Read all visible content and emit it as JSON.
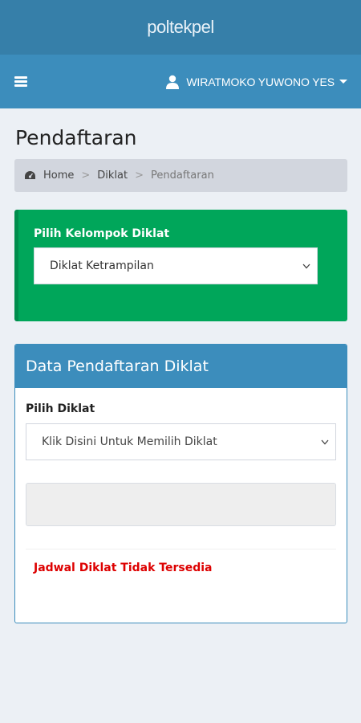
{
  "app": {
    "brand": "poltekpel"
  },
  "navbar": {
    "user_name": "WIRATMOKO YUWONO YES"
  },
  "page": {
    "title": "Pendaftaran"
  },
  "breadcrumb": {
    "home": "Home",
    "diklat": "Diklat",
    "current": "Pendaftaran"
  },
  "kelompok": {
    "label": "Pilih Kelompok Diklat",
    "selected": "Diklat Ketrampilan"
  },
  "pendaftaran": {
    "header": "Data Pendaftaran Diklat",
    "pilih_label": "Pilih Diklat",
    "pilih_selected": "Klik Disini Untuk Memilih Diklat",
    "notice": "Jadwal Diklat Tidak Tersedia"
  },
  "colors": {
    "brand_bar": "#367fa9",
    "navbar": "#3c8dbc",
    "success_box": "#00a65a",
    "notice_text": "#dd0000"
  }
}
